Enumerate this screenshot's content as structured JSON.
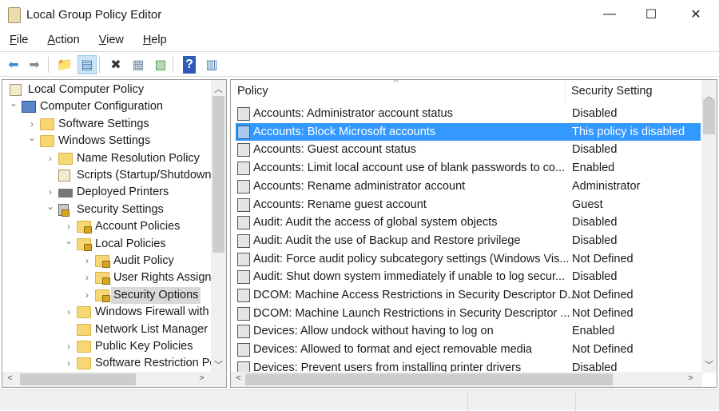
{
  "window": {
    "title": "Local Group Policy Editor",
    "minimize": "—",
    "maximize": "☐",
    "close": "✕"
  },
  "menu": [
    {
      "label": "File",
      "key": "F",
      "rest": "ile"
    },
    {
      "label": "Action",
      "key": "A",
      "rest": "ction"
    },
    {
      "label": "View",
      "key": "V",
      "rest": "iew"
    },
    {
      "label": "Help",
      "key": "H",
      "rest": "elp"
    }
  ],
  "toolbar": [
    {
      "name": "back-icon",
      "glyph": "⬅",
      "color": "#3a8fd9"
    },
    {
      "name": "forward-icon",
      "glyph": "➡",
      "color": "#8a8a8a"
    },
    {
      "name": "up-folder-icon",
      "glyph": "📁",
      "color": "#d9a520"
    },
    {
      "name": "show-hide-tree-icon",
      "glyph": "▤",
      "color": "#4a7ab0"
    },
    {
      "name": "delete-icon",
      "glyph": "✖",
      "color": "#333"
    },
    {
      "name": "properties-icon",
      "glyph": "▦",
      "color": "#7a8ea8"
    },
    {
      "name": "export-list-icon",
      "glyph": "▧",
      "color": "#4a9a4a"
    },
    {
      "name": "help-icon",
      "glyph": "?",
      "color": "#fff"
    },
    {
      "name": "show-action-pane-icon",
      "glyph": "▥",
      "color": "#4a7ab0"
    }
  ],
  "tree": [
    {
      "label": "Local Computer Policy",
      "level": 0,
      "arrow": "",
      "icon": "scroll"
    },
    {
      "label": "Computer Configuration",
      "level": 1,
      "arrow": "v",
      "icon": "computer"
    },
    {
      "label": "Software Settings",
      "level": 2,
      "arrow": ">",
      "icon": "folder"
    },
    {
      "label": "Windows Settings",
      "level": 2,
      "arrow": "v",
      "icon": "folder"
    },
    {
      "label": "Name Resolution Policy",
      "level": 3,
      "arrow": ">",
      "icon": "folder"
    },
    {
      "label": "Scripts (Startup/Shutdown)",
      "level": 3,
      "arrow": "",
      "icon": "script"
    },
    {
      "label": "Deployed Printers",
      "level": 3,
      "arrow": ">",
      "icon": "printer"
    },
    {
      "label": "Security Settings",
      "level": 3,
      "arrow": "v",
      "icon": "security"
    },
    {
      "label": "Account Policies",
      "level": 4,
      "arrow": ">",
      "icon": "lockfolder"
    },
    {
      "label": "Local Policies",
      "level": 4,
      "arrow": "v",
      "icon": "lockfolder"
    },
    {
      "label": "Audit Policy",
      "level": 5,
      "arrow": ">",
      "icon": "lockfolder"
    },
    {
      "label": "User Rights Assignment",
      "level": 5,
      "arrow": ">",
      "icon": "lockfolder"
    },
    {
      "label": "Security Options",
      "level": 5,
      "arrow": ">",
      "icon": "lockfolder",
      "selected": true
    },
    {
      "label": "Windows Firewall with Advanced Security",
      "level": 4,
      "arrow": ">",
      "icon": "folder"
    },
    {
      "label": "Network List Manager Policies",
      "level": 4,
      "arrow": "",
      "icon": "folder"
    },
    {
      "label": "Public Key Policies",
      "level": 4,
      "arrow": ">",
      "icon": "folder"
    },
    {
      "label": "Software Restriction Policies",
      "level": 4,
      "arrow": ">",
      "icon": "folder"
    }
  ],
  "list": {
    "columns": [
      "Policy",
      "Security Setting"
    ],
    "sort_indicator": "^",
    "selection_color": "#3399ff",
    "rows": [
      {
        "policy": "Accounts: Administrator account status",
        "setting": "Disabled"
      },
      {
        "policy": "Accounts: Block Microsoft accounts",
        "setting": "This policy is disabled",
        "selected": true
      },
      {
        "policy": "Accounts: Guest account status",
        "setting": "Disabled"
      },
      {
        "policy": "Accounts: Limit local account use of blank passwords to co...",
        "setting": "Enabled"
      },
      {
        "policy": "Accounts: Rename administrator account",
        "setting": "Administrator"
      },
      {
        "policy": "Accounts: Rename guest account",
        "setting": "Guest"
      },
      {
        "policy": "Audit: Audit the access of global system objects",
        "setting": "Disabled"
      },
      {
        "policy": "Audit: Audit the use of Backup and Restore privilege",
        "setting": "Disabled"
      },
      {
        "policy": "Audit: Force audit policy subcategory settings (Windows Vis...",
        "setting": "Not Defined"
      },
      {
        "policy": "Audit: Shut down system immediately if unable to log secur...",
        "setting": "Disabled"
      },
      {
        "policy": "DCOM: Machine Access Restrictions in Security Descriptor D...",
        "setting": "Not Defined"
      },
      {
        "policy": "DCOM: Machine Launch Restrictions in Security Descriptor ...",
        "setting": "Not Defined"
      },
      {
        "policy": "Devices: Allow undock without having to log on",
        "setting": "Enabled"
      },
      {
        "policy": "Devices: Allowed to format and eject removable media",
        "setting": "Not Defined"
      },
      {
        "policy": "Devices: Prevent users from installing printer drivers",
        "setting": "Disabled"
      }
    ]
  }
}
